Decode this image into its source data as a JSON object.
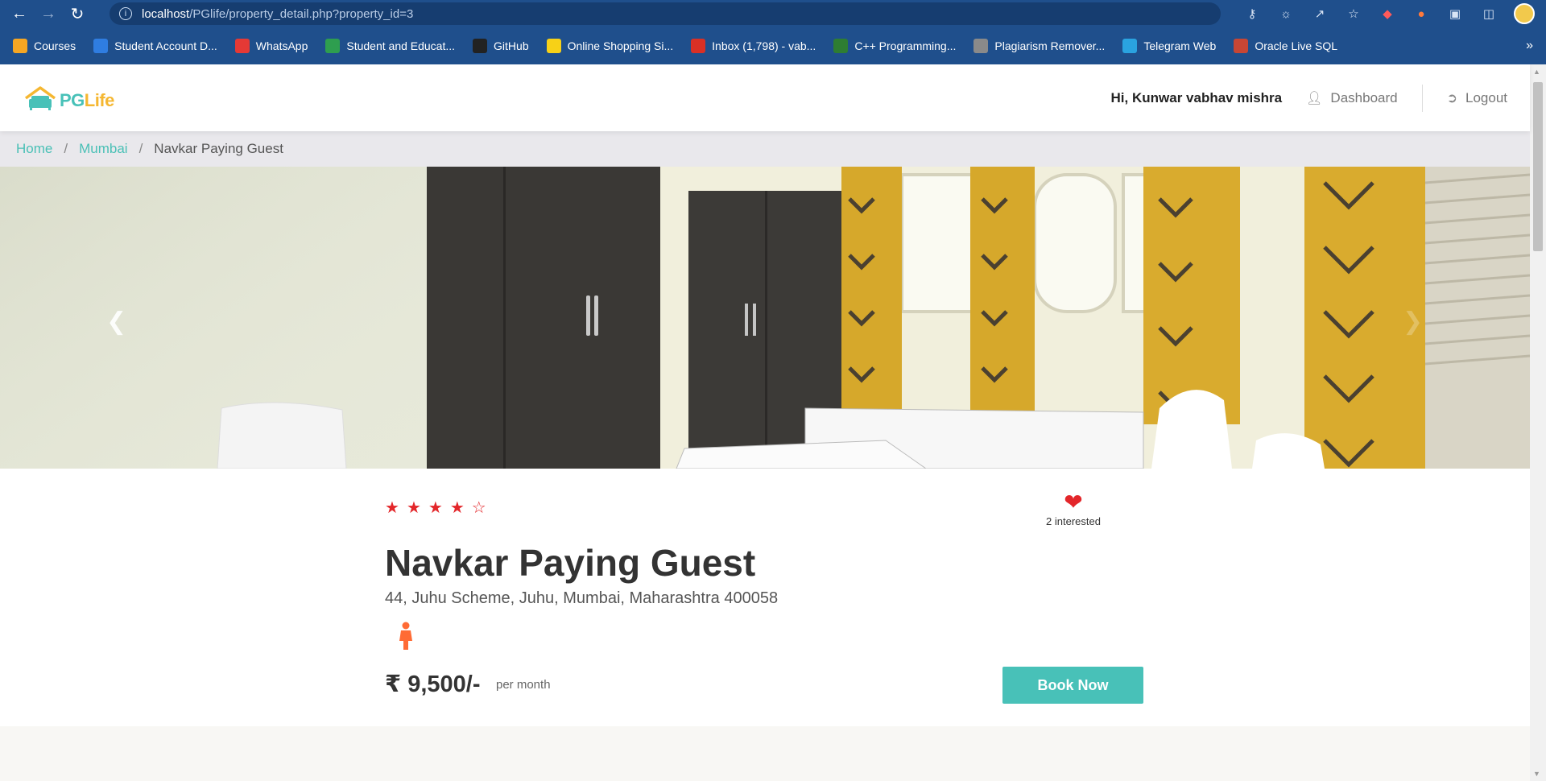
{
  "browser": {
    "url_host": "localhost",
    "url_path": "/PGlife/property_detail.php?property_id=3",
    "bookmarks": [
      {
        "label": "Courses",
        "color": "#f5a623"
      },
      {
        "label": "Student Account D...",
        "color": "#2f7de1"
      },
      {
        "label": "WhatsApp",
        "color": "#e53935"
      },
      {
        "label": "Student and Educat...",
        "color": "#2e9e4f"
      },
      {
        "label": "GitHub",
        "color": "#222222"
      },
      {
        "label": "Online Shopping Si...",
        "color": "#f7d117"
      },
      {
        "label": "Inbox (1,798) - vab...",
        "color": "#d93025"
      },
      {
        "label": "C++ Programming...",
        "color": "#2e7d32"
      },
      {
        "label": "Plagiarism Remover...",
        "color": "#8a8a8a"
      },
      {
        "label": "Telegram Web",
        "color": "#2aa3e0"
      },
      {
        "label": "Oracle Live SQL",
        "color": "#c74634"
      }
    ],
    "more_label": "»"
  },
  "header": {
    "logo_text_1": "PG",
    "logo_text_2": "Life",
    "greeting": "Hi, Kunwar vabhav mishra",
    "dashboard_label": "Dashboard",
    "logout_label": "Logout"
  },
  "breadcrumb": {
    "home": "Home",
    "city": "Mumbai",
    "current": "Navkar Paying Guest",
    "separator": "/"
  },
  "carousel": {
    "prev_icon": "chevron-left-icon",
    "next_icon": "chevron-right-icon"
  },
  "property": {
    "rating": 4,
    "rating_max": 5,
    "interested_text": "2 interested",
    "name": "Navkar Paying Guest",
    "address": "44, Juhu Scheme, Juhu, Mumbai, Maharashtra 400058",
    "gender_icon": "female-icon",
    "price": "₹ 9,500/-",
    "price_unit": "per month",
    "book_label": "Book Now",
    "accent_color": "#48c1b8",
    "heart_color": "#e3262a"
  }
}
